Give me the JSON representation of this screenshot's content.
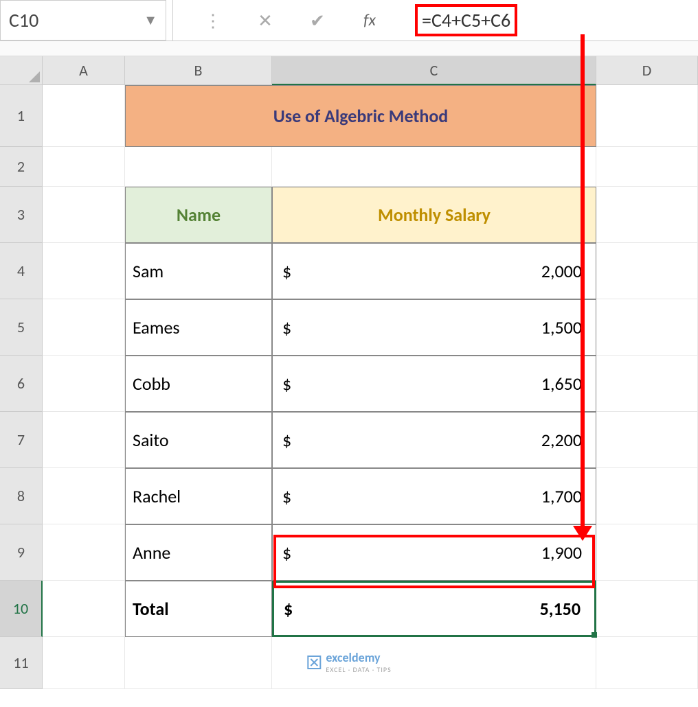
{
  "nameBox": "C10",
  "formula": "=C4+C5+C6",
  "columns": [
    "A",
    "B",
    "C",
    "D"
  ],
  "rowNumbers": [
    "1",
    "2",
    "3",
    "4",
    "5",
    "6",
    "7",
    "8",
    "9",
    "10",
    "11"
  ],
  "title": "Use of Algebric Method",
  "headers": {
    "name": "Name",
    "salary": "Monthly Salary"
  },
  "currencySymbol": "$",
  "rows": [
    {
      "name": "Sam",
      "salary": "2,000"
    },
    {
      "name": "Eames",
      "salary": "1,500"
    },
    {
      "name": "Cobb",
      "salary": "1,650"
    },
    {
      "name": "Saito",
      "salary": "2,200"
    },
    {
      "name": "Rachel",
      "salary": "1,700"
    },
    {
      "name": "Anne",
      "salary": "1,900"
    }
  ],
  "total": {
    "label": "Total",
    "value": "5,150"
  },
  "watermark": {
    "brand": "exceldemy",
    "tag": "EXCEL · DATA · TIPS"
  }
}
